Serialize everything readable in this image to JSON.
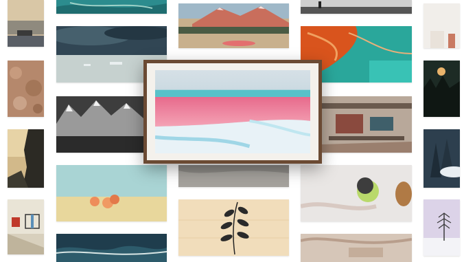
{
  "gallery": {
    "featured": {
      "name": "pink-shore-landscape"
    },
    "tiles": [
      {
        "name": "harbor-sunset"
      },
      {
        "name": "teal-aerial-water"
      },
      {
        "name": "mountain-meadow"
      },
      {
        "name": "black-white-road"
      },
      {
        "name": "white-room"
      },
      {
        "name": "stormy-sea-icebergs"
      },
      {
        "name": "orange-river-aerial"
      },
      {
        "name": "rock-texture"
      },
      {
        "name": "snowy-mountains-bw"
      },
      {
        "name": "abstract-painting"
      },
      {
        "name": "night-trees"
      },
      {
        "name": "misty-cliff"
      },
      {
        "name": "winter-forest"
      },
      {
        "name": "peaches-still-life"
      },
      {
        "name": "gray-sand"
      },
      {
        "name": "leaf-lion-collage"
      },
      {
        "name": "modernist-architecture"
      },
      {
        "name": "botanical-sketch"
      },
      {
        "name": "snowy-tree"
      },
      {
        "name": "ocean-waves-aerial"
      },
      {
        "name": "beige-abstract"
      }
    ]
  }
}
